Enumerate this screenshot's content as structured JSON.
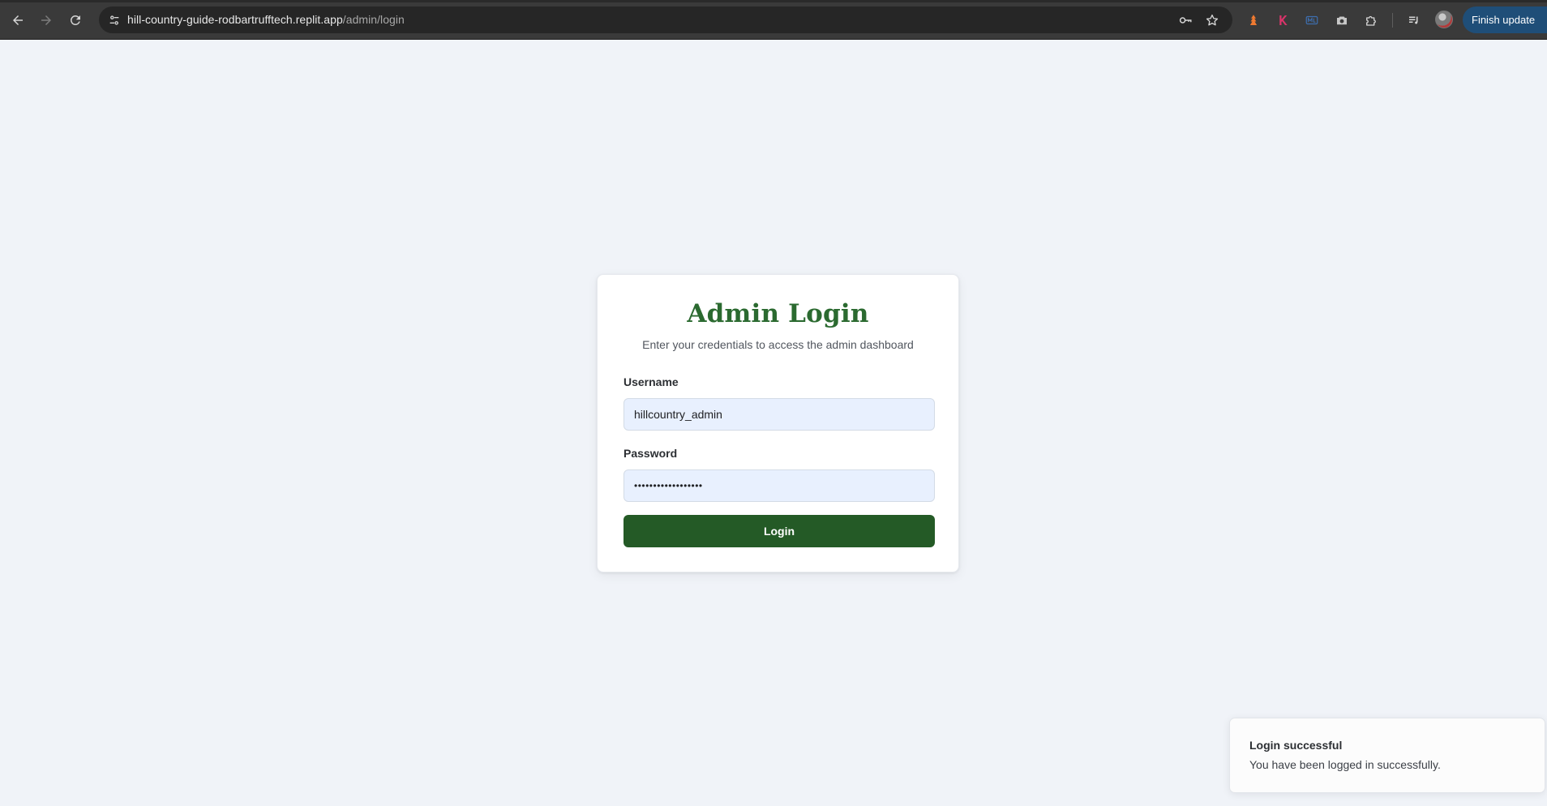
{
  "browser": {
    "url_host": "hill-country-guide-rodbartrufftech.replit.app",
    "url_path": "/admin/login",
    "finish_update_label": "Finish update",
    "icons": {
      "back": "arrow-left-icon",
      "forward": "arrow-right-icon",
      "reload": "reload-icon",
      "site_settings": "tune-icon",
      "password_manager": "key-icon",
      "bookmark": "star-icon",
      "extensions": "puzzle-icon",
      "reading_list": "playlist-icon",
      "more": "more-vertical-icon"
    }
  },
  "login": {
    "title": "Admin Login",
    "subtitle": "Enter your credentials to access the admin dashboard",
    "username_label": "Username",
    "username_value": "hillcountry_admin",
    "password_label": "Password",
    "password_value": "••••••••••••••••••",
    "button_label": "Login"
  },
  "toast": {
    "title": "Login successful",
    "description": "You have been logged in successfully."
  },
  "colors": {
    "page_background": "#f0f3f8",
    "title_green": "#2b6a30",
    "button_green": "#245a26",
    "input_fill": "#e8f0fe",
    "update_button": "#1f4e78"
  }
}
